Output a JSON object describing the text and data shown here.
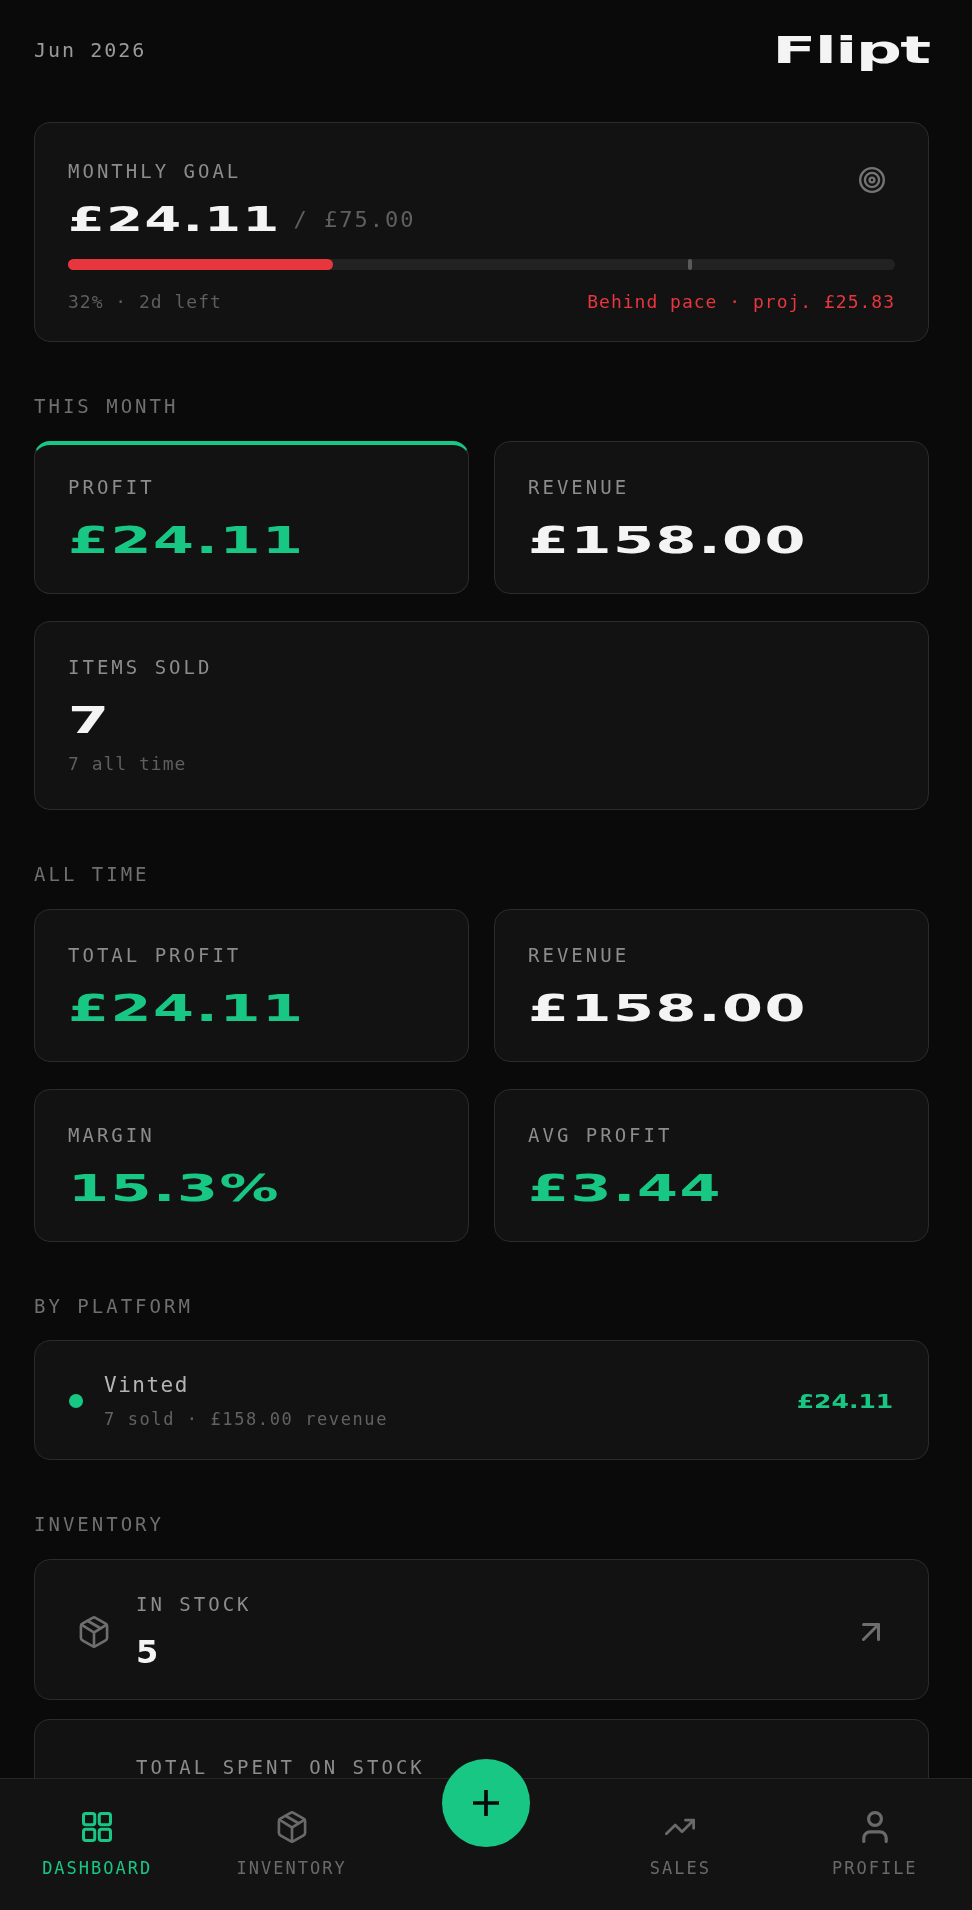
{
  "header": {
    "date": "Jun 2026",
    "logo": "Flipt"
  },
  "goal": {
    "label": "MONTHLY GOAL",
    "value": "£24.11",
    "target": "/ £75.00",
    "level": 0.32,
    "pace": {
      "level": 0.75
    },
    "progress": "32% · 2d left",
    "status": "Behind pace · proj. £25.83",
    "behind": true
  },
  "sections": [
    {
      "title": "THIS MONTH",
      "cards": [
        {
          "label": "PROFIT",
          "value": "£24.11",
          "accent": true,
          "highlighted": true,
          "wide": false
        },
        {
          "label": "REVENUE",
          "value": "£158.00",
          "accent": false,
          "highlighted": false,
          "wide": false
        },
        {
          "label": "ITEMS SOLD",
          "value": "7",
          "note": "7 all time",
          "accent": false,
          "highlighted": false,
          "wide": true
        }
      ]
    },
    {
      "title": "ALL TIME",
      "cards": [
        {
          "label": "TOTAL PROFIT",
          "value": "£24.11",
          "accent": true,
          "highlighted": false,
          "wide": false
        },
        {
          "label": "REVENUE",
          "value": "£158.00",
          "accent": false,
          "highlighted": false,
          "wide": false
        },
        {
          "label": "MARGIN",
          "value": "15.3%",
          "accent": true,
          "highlighted": false,
          "wide": false
        },
        {
          "label": "AVG PROFIT",
          "value": "£3.44",
          "accent": true,
          "highlighted": false,
          "wide": false
        }
      ]
    }
  ],
  "platforms": {
    "title": "BY PLATFORM",
    "items": [
      {
        "name": "Vinted",
        "detail": "7 sold · £158.00 revenue",
        "profit": "£24.11",
        "color": "#19c784"
      }
    ]
  },
  "inventory": {
    "title": "INVENTORY",
    "items": [
      {
        "label": "IN STOCK",
        "value": "5"
      },
      {
        "label": "TOTAL SPENT ON STOCK"
      }
    ]
  },
  "nav": {
    "items": [
      {
        "label": "DASHBOARD",
        "selected": true
      },
      {
        "label": "INVENTORY",
        "selected": false
      },
      {
        "label": "SALES",
        "selected": false
      },
      {
        "label": "PROFILE",
        "selected": false
      }
    ]
  }
}
